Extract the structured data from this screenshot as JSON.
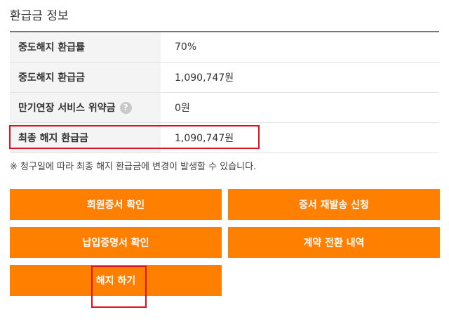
{
  "section_title": "환급금 정보",
  "rows": [
    {
      "label": "중도해지 환급률",
      "value": "70%"
    },
    {
      "label": "중도해지 환급금",
      "value": "1,090,747원"
    },
    {
      "label": "만기연장 서비스 위약금",
      "value": "0원",
      "help_icon": "?"
    },
    {
      "label": "최종 해지 환급금",
      "value": "1,090,747원"
    }
  ],
  "note": "※ 청구일에 따라 최종 해지 환급금에 변경이 발생할 수 있습니다.",
  "buttons": {
    "member_cert": "회원증서 확인",
    "cert_reissue": "증서 재발송 신청",
    "payment_cert": "납입증명서 확인",
    "contract_switch": "계약 전환 내역",
    "terminate": "해지 하기"
  },
  "colors": {
    "accent": "#ff7f00",
    "highlight": "#e0121e"
  }
}
